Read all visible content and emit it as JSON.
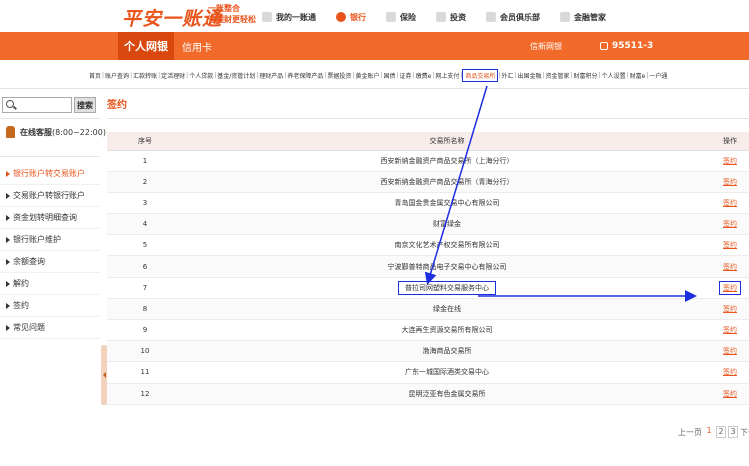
{
  "header": {
    "logo": "平安一账通",
    "slogan_line1": "一账整合",
    "slogan_line2": "让理财更轻松",
    "nav": [
      {
        "label": "我的一账通",
        "active": false
      },
      {
        "label": "银行",
        "active": true
      },
      {
        "label": "保险",
        "active": false
      },
      {
        "label": "投资",
        "active": false
      },
      {
        "label": "会员俱乐部",
        "active": false
      },
      {
        "label": "金融管家",
        "active": false
      }
    ]
  },
  "menubar": {
    "tab_personal": "个人网银",
    "tab_credit": "信用卡",
    "news": "信新网银",
    "phone": "95511-3"
  },
  "subnav": [
    "首页",
    "账户查询",
    "汇款转账",
    "定活理财",
    "个人贷款",
    "基金/资管计划",
    "理财产品",
    "养老保障产品",
    "票据投资",
    "黄金账户",
    "国债",
    "证券",
    "缴费e",
    "网上支付",
    "商品交易所",
    "外汇",
    "出国金融",
    "资金管家",
    "财富积分",
    "个人设置",
    "财富e",
    "一户通"
  ],
  "subnav_highlight": "商品交易所",
  "sidebar": {
    "search_button": "搜索",
    "online_label": "在线客服",
    "online_hours": "(8:00~22:00)",
    "items": [
      {
        "label": "银行账户转交易账户",
        "active": true
      },
      {
        "label": "交易账户转银行账户",
        "active": false
      },
      {
        "label": "资金划转明细查询",
        "active": false
      },
      {
        "label": "银行账户维护",
        "active": false
      },
      {
        "label": "余额查询",
        "active": false
      },
      {
        "label": "解约",
        "active": false
      },
      {
        "label": "签约",
        "active": false
      },
      {
        "label": "常见问题",
        "active": false
      }
    ]
  },
  "main": {
    "title": "签约",
    "columns": [
      "序号",
      "交易所名称",
      "操作"
    ],
    "rows": [
      {
        "no": "1",
        "name": "西安新纳金融资产商品交易所（上海分行）",
        "op": "签约"
      },
      {
        "no": "2",
        "name": "西安新纳金融资产商品交易所（青海分行）",
        "op": "签约"
      },
      {
        "no": "3",
        "name": "青岛国金贵金属交易中心有限公司",
        "op": "签约"
      },
      {
        "no": "4",
        "name": "财富绿金",
        "op": "签约"
      },
      {
        "no": "5",
        "name": "南京文化艺术产权交易所有限公司",
        "op": "签约"
      },
      {
        "no": "6",
        "name": "宁波鄞普特商品电子交易中心有限公司",
        "op": "签约"
      },
      {
        "no": "7",
        "name": "普拉司网塑料交易服务中心",
        "op": "签约"
      },
      {
        "no": "8",
        "name": "绿金在线",
        "op": "签约"
      },
      {
        "no": "9",
        "name": "大连再生资源交易所有限公司",
        "op": "签约"
      },
      {
        "no": "10",
        "name": "渤海商品交易所",
        "op": "签约"
      },
      {
        "no": "11",
        "name": "广东一城国际酒类交易中心",
        "op": "签约"
      },
      {
        "no": "12",
        "name": "昆明泛亚有色金属交易所",
        "op": "签约"
      }
    ],
    "highlight_row": 7
  },
  "pager": {
    "prev": "上一页",
    "pages": [
      "1",
      "2",
      "3"
    ],
    "current": "1",
    "next": "下一"
  },
  "colors": {
    "brand": "#f26a2a",
    "brand_dark": "#d9480f",
    "link": "#e8541c",
    "annotation": "#1c2ee0"
  }
}
